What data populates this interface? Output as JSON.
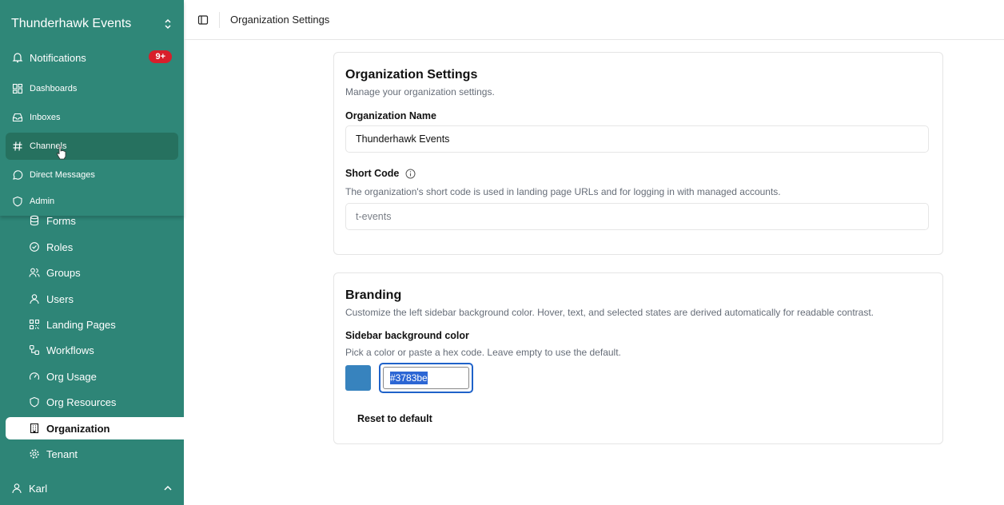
{
  "sidebar": {
    "org_name": "Thunderhawk Events",
    "notifications": {
      "label": "Notifications",
      "badge": "9+"
    },
    "top_items": [
      {
        "label": "Dashboards",
        "icon": "dashboard-icon"
      },
      {
        "label": "Inboxes",
        "icon": "inbox-icon"
      },
      {
        "label": "Channels",
        "icon": "hash-icon"
      },
      {
        "label": "Direct Messages",
        "icon": "message-circle-icon"
      },
      {
        "label": "Admin",
        "icon": "shield-icon"
      }
    ],
    "admin_items": [
      {
        "label": "Forms",
        "icon": "cylinder-icon"
      },
      {
        "label": "Roles",
        "icon": "badge-check-icon"
      },
      {
        "label": "Groups",
        "icon": "users-icon"
      },
      {
        "label": "Users",
        "icon": "user-icon"
      },
      {
        "label": "Landing Pages",
        "icon": "qr-code-icon"
      },
      {
        "label": "Workflows",
        "icon": "workflow-icon"
      },
      {
        "label": "Org Usage",
        "icon": "gauge-icon"
      },
      {
        "label": "Org Resources",
        "icon": "shield-icon"
      },
      {
        "label": "Organization",
        "icon": "building-icon"
      },
      {
        "label": "Tenant",
        "icon": "gear-icon"
      }
    ],
    "user": "Karl"
  },
  "header": {
    "title": "Organization Settings"
  },
  "org_settings": {
    "title": "Organization Settings",
    "subtitle": "Manage your organization settings.",
    "name_label": "Organization Name",
    "name_value": "Thunderhawk Events",
    "short_code_label": "Short Code",
    "short_code_help": "The organization's short code is used in landing page URLs and for logging in with managed accounts.",
    "short_code_value": "t-events"
  },
  "branding": {
    "title": "Branding",
    "subtitle": "Customize the left sidebar background color. Hover, text, and selected states are derived automatically for readable contrast.",
    "color_label": "Sidebar background color",
    "color_help": "Pick a color or paste a hex code. Leave empty to use the default.",
    "color_value": "#3783be",
    "reset_label": "Reset to default"
  },
  "colors": {
    "sidebar": "#2e8577",
    "swatch": "#3783be",
    "badge": "#d81f2b",
    "focus": "#1f62c9"
  }
}
